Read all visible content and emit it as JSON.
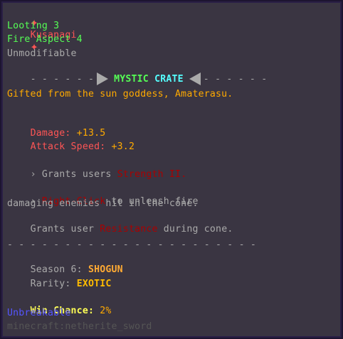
{
  "item": {
    "name_prefix": "✦",
    "name": "Kusanagi",
    "name_suffix": "✦",
    "enchant_1": "Looting 3",
    "enchant_2": "Fire Aspect 4",
    "unmodifiable": "Unmodifiable",
    "divider_left": "- - - - - -",
    "crate_part_1": "MYSTIC",
    "crate_part_2": "CRATE",
    "divider_right": "- - - - - -",
    "lore": "Gifted from the sun goddess, Amaterasu.",
    "damage_label": "Damage: ",
    "damage_value": "+13.5",
    "speed_label": "Attack Speed: ",
    "speed_value": "+3.2",
    "grant_1_prefix": "› Grants users ",
    "grant_1_effect": "Strength II.",
    "ability_prefix": "› ",
    "ability_key": "Right-Click",
    "ability_text": " to unleash fire",
    "ability_line_2": "damaging enemies hit in the cone.",
    "ability_line_3_prefix": "Grants user ",
    "ability_line_3_effect": "Resistance",
    "ability_line_3_suffix": " during cone.",
    "separator": "- - - - - - - - - - - - - - - - - - - - - -",
    "season_label": "Season 6: ",
    "season_value": "SHOGUN",
    "rarity_label": "Rarity: ",
    "rarity_value": "EXOTIC",
    "win_label": "Win Chance:",
    "win_value": " 2%",
    "unbreakable": "Unbreakable",
    "item_id": "minecraft:netherite_sword"
  },
  "colors": {
    "background": "#3a3542",
    "name": "#ff5555",
    "enchant": "#55ff55",
    "gray": "#aaaaaa",
    "gold": "#ffaa00",
    "dark_red": "#aa0000",
    "blue": "#5555ff",
    "yellow": "#ffff55",
    "dark_gray": "#555555"
  }
}
